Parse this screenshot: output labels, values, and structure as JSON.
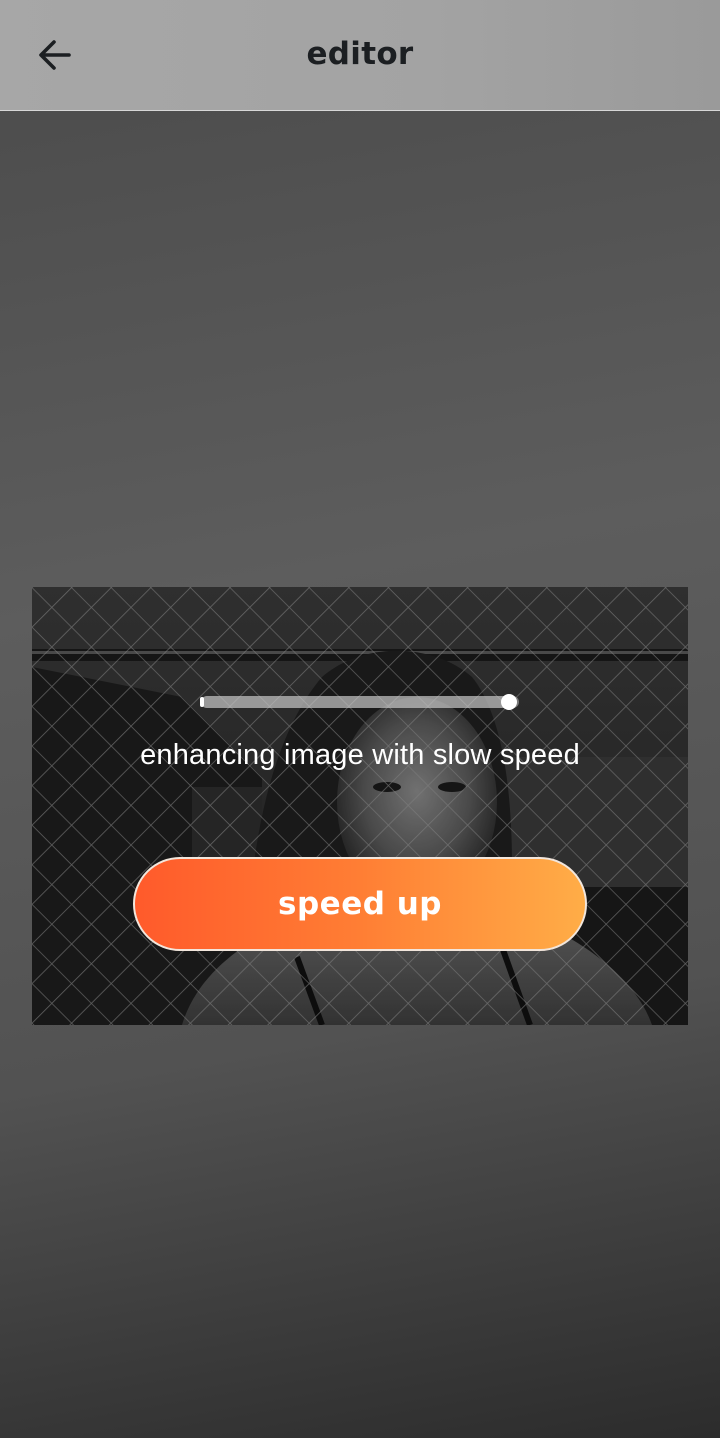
{
  "header": {
    "title": "editor",
    "back_icon": "arrow-left-icon"
  },
  "editor": {
    "photo_description_icon": "photo",
    "progress_fraction": 0.97,
    "status_text": "enhancing image with slow speed",
    "speed_up_label": "speed up"
  },
  "colors": {
    "button_gradient_start": "#ff5a2b",
    "button_gradient_end": "#ffad47",
    "header_bg": "#a5a5a5",
    "title_color": "#1c1f22"
  }
}
